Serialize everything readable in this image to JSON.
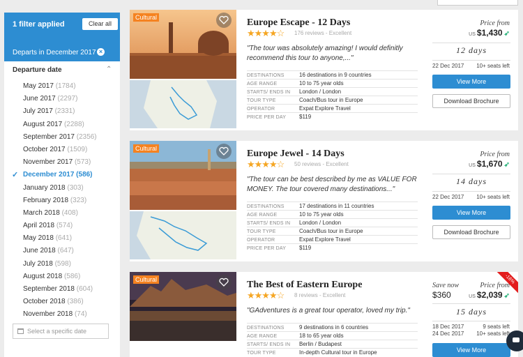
{
  "filters": {
    "applied_label": "1 filter applied",
    "clear_label": "Clear all",
    "active_tag": "Departs in December 2017"
  },
  "departure": {
    "title": "Departure date",
    "months": [
      {
        "label": "May 2017",
        "count": "(1784)",
        "selected": false
      },
      {
        "label": "June 2017",
        "count": "(2297)",
        "selected": false
      },
      {
        "label": "July 2017",
        "count": "(2331)",
        "selected": false
      },
      {
        "label": "August 2017",
        "count": "(2288)",
        "selected": false
      },
      {
        "label": "September 2017",
        "count": "(2356)",
        "selected": false
      },
      {
        "label": "October 2017",
        "count": "(1509)",
        "selected": false
      },
      {
        "label": "November 2017",
        "count": "(573)",
        "selected": false
      },
      {
        "label": "December 2017",
        "count": "(586)",
        "selected": true
      },
      {
        "label": "January 2018",
        "count": "(303)",
        "selected": false
      },
      {
        "label": "February 2018",
        "count": "(323)",
        "selected": false
      },
      {
        "label": "March 2018",
        "count": "(408)",
        "selected": false
      },
      {
        "label": "April 2018",
        "count": "(574)",
        "selected": false
      },
      {
        "label": "May 2018",
        "count": "(641)",
        "selected": false
      },
      {
        "label": "June 2018",
        "count": "(647)",
        "selected": false
      },
      {
        "label": "July 2018",
        "count": "(598)",
        "selected": false
      },
      {
        "label": "August 2018",
        "count": "(586)",
        "selected": false
      },
      {
        "label": "September 2018",
        "count": "(604)",
        "selected": false
      },
      {
        "label": "October 2018",
        "count": "(386)",
        "selected": false
      },
      {
        "label": "November 2018",
        "count": "(74)",
        "selected": false
      }
    ],
    "date_placeholder": "Select a specific date"
  },
  "detail_keys": {
    "destinations": "DESTINATIONS",
    "age_range": "AGE RANGE",
    "starts_ends": "STARTS/ ENDS IN",
    "tour_type": "TOUR TYPE",
    "operator": "OPERATOR",
    "price_per_day": "PRICE PER DAY"
  },
  "labels": {
    "price_from": "Price from",
    "currency": "US",
    "view_more": "View More",
    "download": "Download Brochure",
    "save_now": "Save now"
  },
  "tours": [
    {
      "badge": "Cultural",
      "name": "Europe Escape - 12 Days",
      "stars": "★★★★☆",
      "reviews": "176 reviews - Excellent",
      "quote": "\"The tour was absolutely amazing! I would definitly recommend this tour to anyone,...\"",
      "destinations": "16 destinations in 9 countries",
      "age_range": "10 to 75 year olds",
      "starts_ends": "London / London",
      "tour_type": "Coach/Bus tour in Europe",
      "operator": "Expat Explore Travel",
      "price_per_day": "$119",
      "price": "$1,430",
      "days": "12  days",
      "date1": "22 Dec 2017",
      "seats1": "10+ seats left"
    },
    {
      "badge": "Cultural",
      "name": "Europe Jewel - 14 Days",
      "stars": "★★★★☆",
      "reviews": "50 reviews - Excellent",
      "quote": "\"The tour can be best described by me as VALUE FOR MONEY. The tour covered many destinations...\"",
      "destinations": "17 destinations in 11 countries",
      "age_range": "10 to 75 year olds",
      "starts_ends": "London / London",
      "tour_type": "Coach/Bus tour in Europe",
      "operator": "Expat Explore Travel",
      "price_per_day": "$119",
      "price": "$1,670",
      "days": "14  days",
      "date1": "22 Dec 2017",
      "seats1": "10+ seats left"
    },
    {
      "badge": "Cultural",
      "name": "The Best of Eastern Europe",
      "stars": "★★★★☆",
      "reviews": "8 reviews - Excellent",
      "quote": "\"GAdventures is a great tour operator, loved my trip.\"",
      "destinations": "9 destinations in 6 countries",
      "age_range": "18 to 65 year olds",
      "starts_ends": "Berlin / Budapest",
      "tour_type": "In-depth Cultural tour in Europe",
      "price": "$2,039",
      "save_amount": "$360",
      "discount": "-16%",
      "days": "15  days",
      "date1": "18 Dec 2017",
      "seats1": "9 seats left",
      "date2": "24 Dec 2017",
      "seats2": "10+ seats left"
    }
  ],
  "colors": {
    "brand_blue": "#2d8dd2",
    "badge_orange": "#f58220",
    "star_gold": "#f5a623",
    "discount_red": "#e31d1d"
  }
}
